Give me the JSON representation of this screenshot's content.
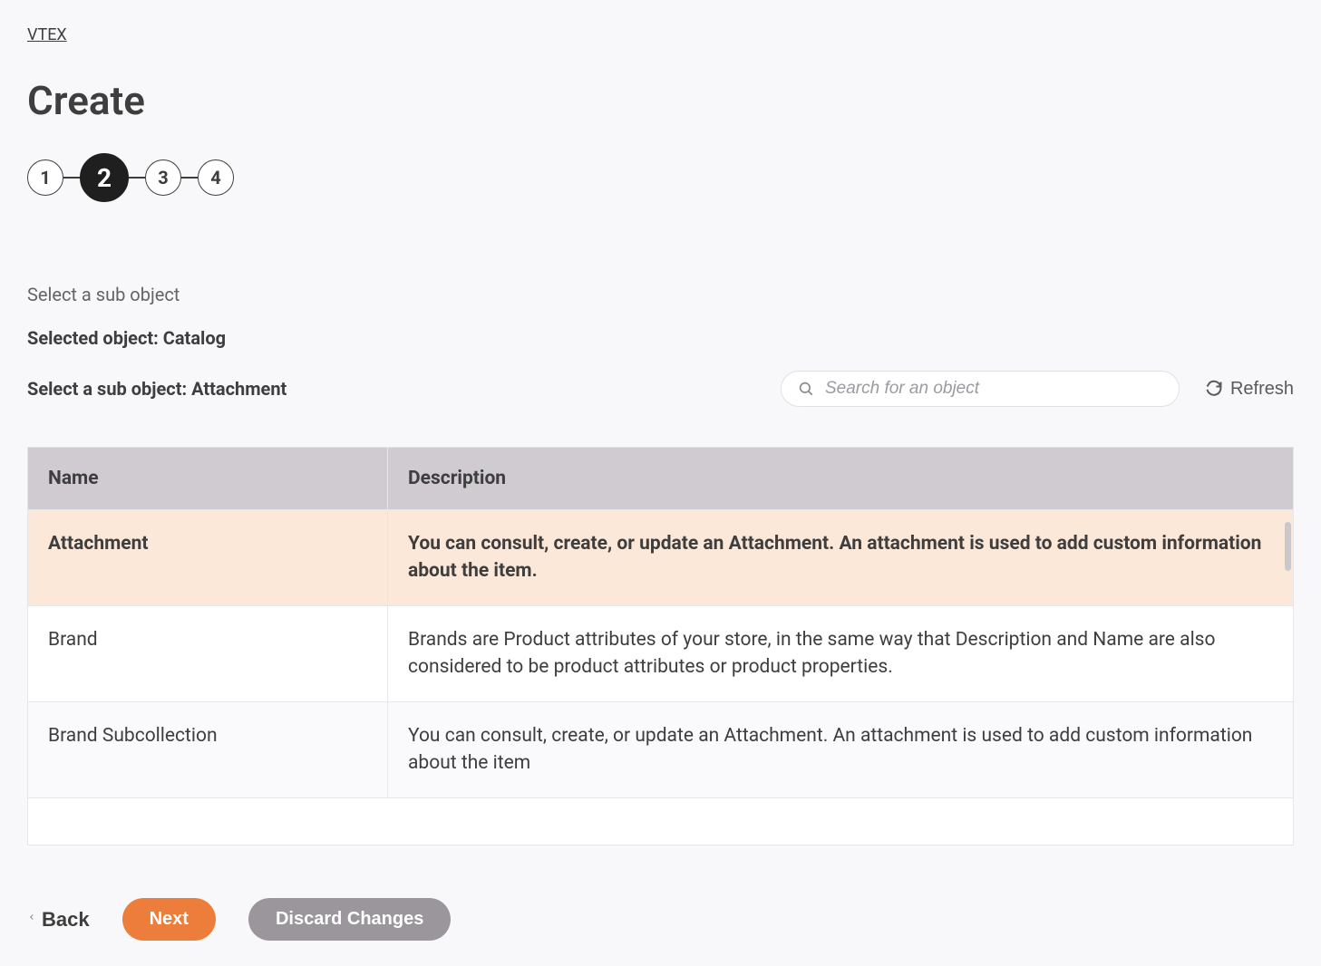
{
  "breadcrumb": {
    "label": "VTEX"
  },
  "page_title": "Create",
  "stepper": {
    "steps": [
      "1",
      "2",
      "3",
      "4"
    ],
    "active_index": 1
  },
  "subtitle": "Select a sub object",
  "selected_object_prefix": "Selected object: ",
  "selected_object_value": "Catalog",
  "select_sub_prefix": "Select a sub object: ",
  "select_sub_value": "Attachment",
  "search": {
    "placeholder": "Search for an object"
  },
  "refresh_label": "Refresh",
  "table": {
    "headers": {
      "name": "Name",
      "description": "Description"
    },
    "rows": [
      {
        "name": "Attachment",
        "description": "You can consult, create, or update an Attachment. An attachment is used to add custom information about the item.",
        "selected": true
      },
      {
        "name": "Brand",
        "description": "Brands are Product attributes of your store, in the same way that Description and Name are also considered to be product attributes or product properties.",
        "selected": false
      },
      {
        "name": "Brand Subcollection",
        "description": "You can consult, create, or update an Attachment. An attachment is used to add custom information about the item",
        "selected": false
      }
    ]
  },
  "footer": {
    "back": "Back",
    "next": "Next",
    "discard": "Discard Changes"
  }
}
